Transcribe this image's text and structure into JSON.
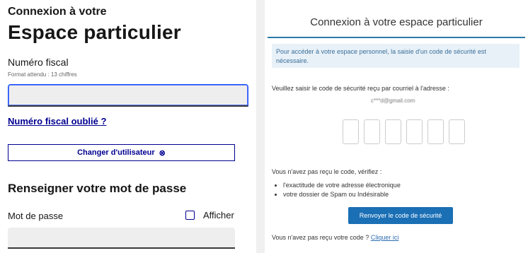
{
  "left": {
    "subtitle": "Connexion à votre",
    "title": "Espace particulier",
    "fiscal_label": "Numéro fiscal",
    "fiscal_hint": "Format attendu : 13 chiffres",
    "fiscal_value": "",
    "forgot_link": "Numéro fiscal oublié ?",
    "change_user_button": "Changer d'utilisateur",
    "close_icon": "⊗",
    "password_heading": "Renseigner votre mot de passe",
    "password_label": "Mot de passe",
    "show_label": "Afficher",
    "password_value": ""
  },
  "right": {
    "header": "Connexion à votre espace particulier",
    "info": "Pour accéder à votre espace personnel, la saisie d'un code de sécurité est nécessaire.",
    "instruction": "Veuillez saisir le code de sécurité reçu par courriel à l'adresse :",
    "email": "c***d@gmail.com",
    "no_code_check": "Vous n'avez pas reçu le code, vérifiez :",
    "checklist": [
      "l'exactitude de votre adresse électronique",
      "votre dossier de Spam ou Indésirable"
    ],
    "resend_button": "Renvoyer le code de sécurité",
    "no_code_prefix": "Vous n'avez pas reçu votre code ?",
    "click_here": "Cliquer ici"
  }
}
